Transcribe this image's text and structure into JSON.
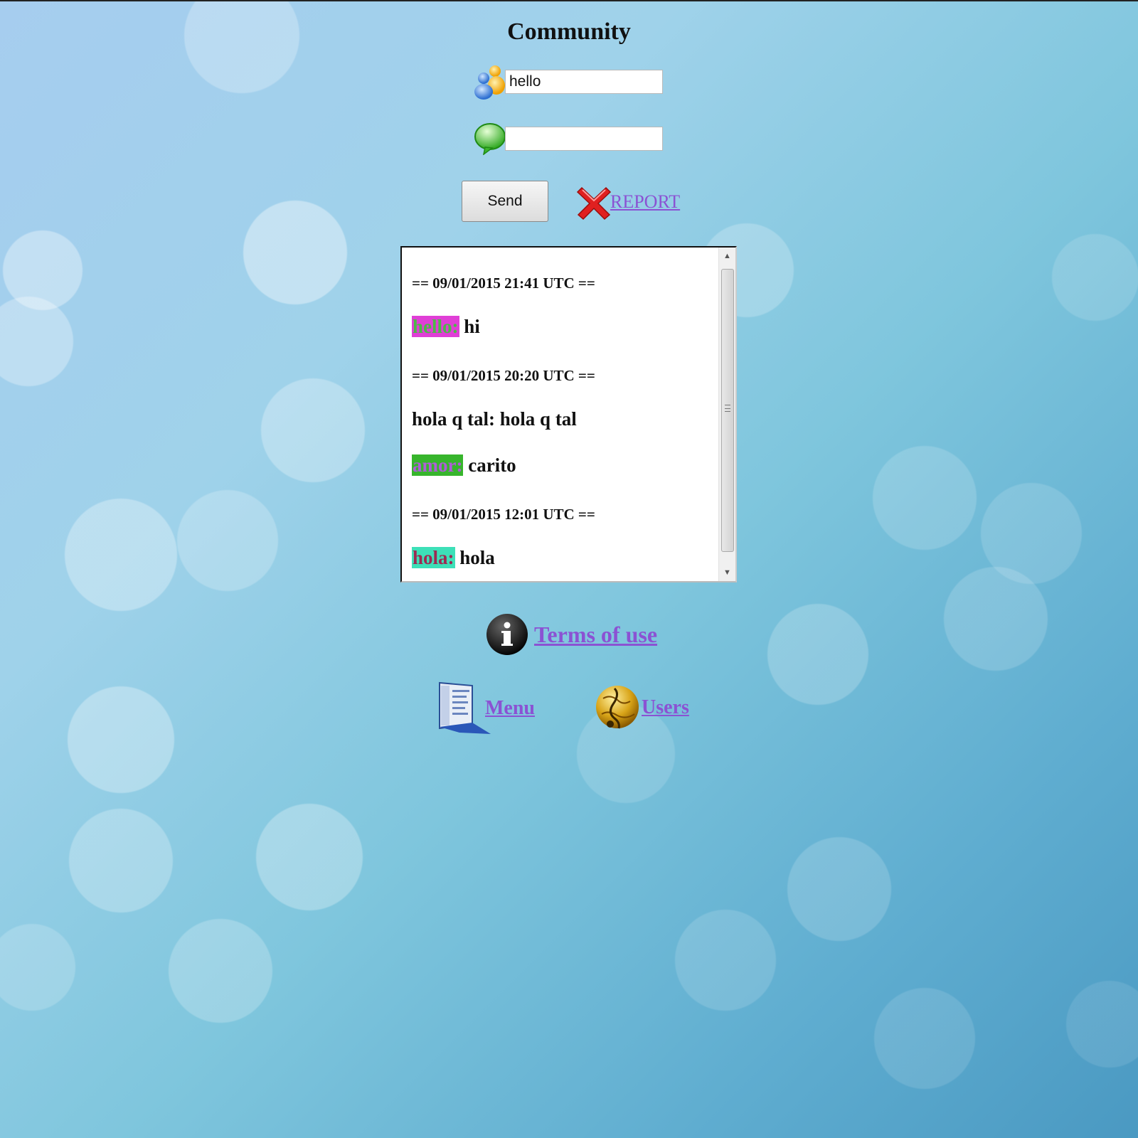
{
  "page": {
    "title": "Community"
  },
  "form": {
    "nick_value": "hello",
    "nick_placeholder": "",
    "message_value": "",
    "message_placeholder": "",
    "send_label": "Send",
    "report_label": "REPORT"
  },
  "chat": {
    "stamps": [
      "== 09/01/2015 21:41 UTC ==",
      "== 09/01/2015 20:20 UTC ==",
      "== 09/01/2015 12:01 UTC =="
    ],
    "messages": [
      {
        "nick": "hello:",
        "text": "hi",
        "nick_bg": "#e03fd6",
        "nick_color": "#4db848"
      },
      {
        "nick": "hola q tal:",
        "text": "hola q tal",
        "nick_bg": "",
        "nick_color": "#111111"
      },
      {
        "nick": "amor:",
        "text": "carito",
        "nick_bg": "#37b52c",
        "nick_color": "#b05cd8"
      },
      {
        "nick": "hola:",
        "text": "hola",
        "nick_bg": "#3de0b8",
        "nick_color": "#9d2a52"
      }
    ]
  },
  "footer": {
    "terms_label": "Terms of use",
    "menu_label": "Menu",
    "users_label": "Users"
  },
  "icons": {
    "nick": "users-icon",
    "message": "speech-bubble-icon",
    "report": "red-x-icon",
    "terms": "info-icon",
    "menu": "window-screenshot-icon",
    "users": "music-globe-icon"
  },
  "colors": {
    "link": "#8b52d3"
  }
}
